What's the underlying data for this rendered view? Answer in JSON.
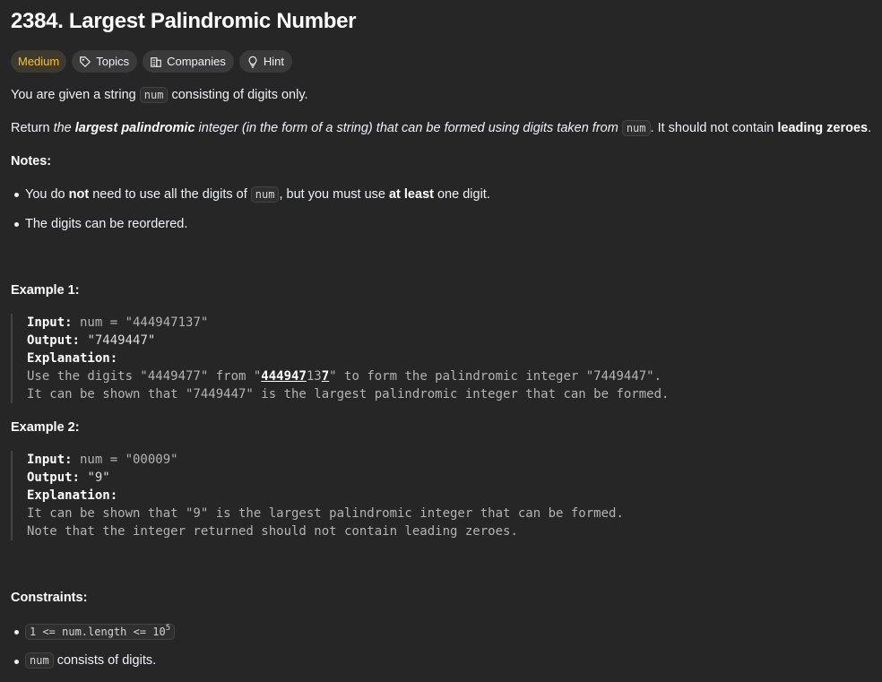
{
  "problem": {
    "title": "2384. Largest Palindromic Number",
    "difficulty": "Medium",
    "tags": {
      "topics": "Topics",
      "companies": "Companies",
      "hint": "Hint"
    },
    "intro": {
      "a": "You are given a string ",
      "code": "num",
      "b": " consisting of digits only."
    },
    "return": {
      "a": "Return ",
      "b": "the ",
      "c": "largest palindromic",
      "d": " integer (in the form of a string) that can be formed using digits taken from ",
      "code": "num",
      "e": ". It should not contain ",
      "f": "leading zeroes",
      "g": "."
    },
    "notes_heading": "Notes:",
    "notes": [
      {
        "a": "You do ",
        "b": "not",
        "c": " need to use all the digits of ",
        "code": "num",
        "d": ", but you must use ",
        "e": "at least",
        "f": " one digit."
      },
      {
        "a": "The digits can be reordered."
      }
    ],
    "examples": [
      {
        "heading": "Example 1:",
        "input_label": "Input:",
        "input": " num = \"444947137\"",
        "output_label": "Output:",
        "output": " \"7449447\"",
        "explanation_label": "Explanation:",
        "line1a": "Use the digits \"4449477\" from \"",
        "line1u1": "444947",
        "line1b": "13",
        "line1u2": "7",
        "line1c": "\" to form the palindromic integer \"7449447\".",
        "line2": "It can be shown that \"7449447\" is the largest palindromic integer that can be formed."
      },
      {
        "heading": "Example 2:",
        "input_label": "Input:",
        "input": " num = \"00009\"",
        "output_label": "Output:",
        "output": " \"9\"",
        "explanation_label": "Explanation:",
        "line1": "It can be shown that \"9\" is the largest palindromic integer that can be formed.",
        "line2": "Note that the integer returned should not contain leading zeroes."
      }
    ],
    "constraints_heading": "Constraints:",
    "constraints": [
      {
        "code": "1 <= num.length <= 10",
        "sup": "5"
      },
      {
        "code": "num",
        "text": " consists of digits."
      }
    ]
  }
}
